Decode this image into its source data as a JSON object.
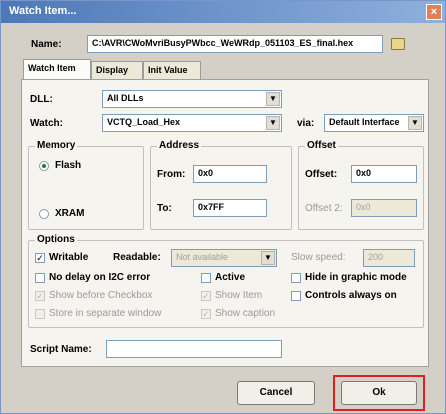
{
  "window": {
    "title": "Watch Item...",
    "close_glyph": "×"
  },
  "name": {
    "label": "Name:",
    "value": "C:\\AVR\\CWoMvriBusyPWbcc_WeWRdp_051103_ES_final.hex"
  },
  "tabs": [
    {
      "label": "Watch Item",
      "active": true
    },
    {
      "label": "Display",
      "active": false
    },
    {
      "label": "Init Value",
      "active": false
    }
  ],
  "dll": {
    "label": "DLL:",
    "value": "All DLLs"
  },
  "watch": {
    "label": "Watch:",
    "value": "VCTQ_Load_Hex"
  },
  "via": {
    "label": "via:",
    "value": "Default Interface"
  },
  "memory": {
    "title": "Memory",
    "options": [
      {
        "label": "Flash",
        "selected": true
      },
      {
        "label": "XRAM",
        "selected": false
      }
    ]
  },
  "address": {
    "title": "Address",
    "from_label": "From:",
    "from_value": "0x0",
    "to_label": "To:",
    "to_value": "0x7FF"
  },
  "offset": {
    "title": "Offset",
    "offset_label": "Offset:",
    "offset_value": "0x0",
    "offset2_label": "Offset 2:",
    "offset2_value": "0x0"
  },
  "options": {
    "title": "Options",
    "writable": {
      "label": "Writable",
      "checked": true
    },
    "readable_label": "Readable:",
    "readable_value": "Not available",
    "slow_speed_label": "Slow speed:",
    "slow_speed_value": "200",
    "no_delay": {
      "label": "No delay on I2C error",
      "checked": false
    },
    "active": {
      "label": "Active",
      "checked": false
    },
    "hide_graphic": {
      "label": "Hide in graphic mode",
      "checked": false
    },
    "show_before": {
      "label": "Show before Checkbox",
      "checked": true
    },
    "show_item": {
      "label": "Show Item",
      "checked": true
    },
    "controls_always_on": {
      "label": "Controls always on",
      "checked": false
    },
    "store_separate": {
      "label": "Store in separate window",
      "checked": false
    },
    "show_caption": {
      "label": "Show caption",
      "checked": true
    }
  },
  "script": {
    "label": "Script Name:",
    "value": ""
  },
  "buttons": {
    "cancel": "Cancel",
    "ok": "Ok"
  },
  "colors": {
    "title_start": "#4d78b8",
    "title_end": "#8eb0de",
    "highlight": "#e02020"
  },
  "icons": {
    "arrow": "▼",
    "check": "✓"
  }
}
